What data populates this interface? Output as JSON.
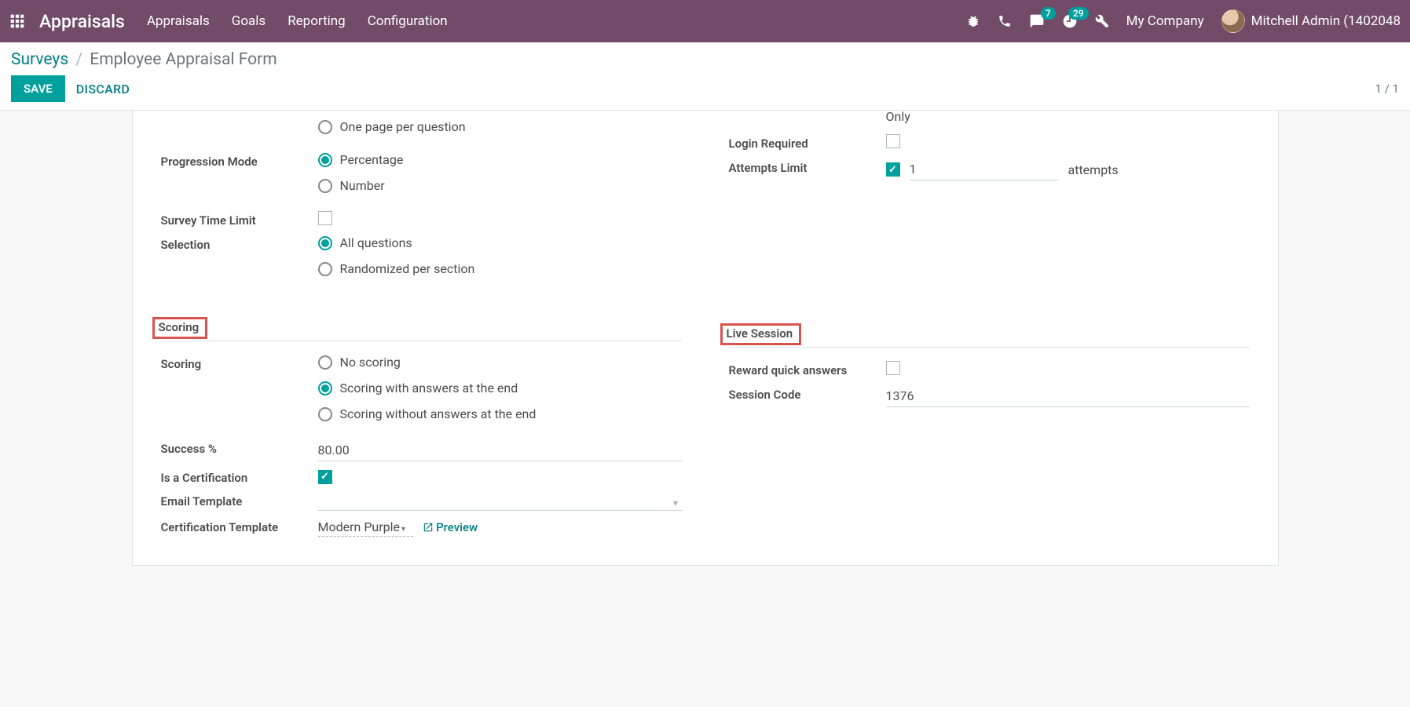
{
  "nav": {
    "app_title": "Appraisals",
    "menu": [
      "Appraisals",
      "Goals",
      "Reporting",
      "Configuration"
    ],
    "msg_badge": "7",
    "activity_badge": "29",
    "company": "My Company",
    "user": "Mitchell Admin (1402048"
  },
  "breadcrumb": {
    "parent": "Surveys",
    "current": "Employee Appraisal Form"
  },
  "buttons": {
    "save": "SAVE",
    "discard": "DISCARD"
  },
  "pager": "1 / 1",
  "left": {
    "truncated_option": "One page per question",
    "progression_mode": {
      "label": "Progression Mode",
      "opts": [
        "Percentage",
        "Number"
      ],
      "selected": 0
    },
    "time_limit_label": "Survey Time Limit",
    "selection": {
      "label": "Selection",
      "opts": [
        "All questions",
        "Randomized per section"
      ],
      "selected": 0
    },
    "scoring_header": "Scoring",
    "scoring": {
      "label": "Scoring",
      "opts": [
        "No scoring",
        "Scoring with answers at the end",
        "Scoring without answers at the end"
      ],
      "selected": 1
    },
    "success": {
      "label": "Success %",
      "value": "80.00"
    },
    "is_cert_label": "Is a Certification",
    "email_template_label": "Email Template",
    "cert_template": {
      "label": "Certification Template",
      "value": "Modern Purple",
      "preview": "Preview"
    }
  },
  "right": {
    "truncated_top": "Only",
    "login_required_label": "Login Required",
    "attempts": {
      "label": "Attempts Limit",
      "value": "1",
      "suffix": "attempts"
    },
    "live_header": "Live Session",
    "reward_label": "Reward quick answers",
    "session_code": {
      "label": "Session Code",
      "value": "1376"
    }
  }
}
